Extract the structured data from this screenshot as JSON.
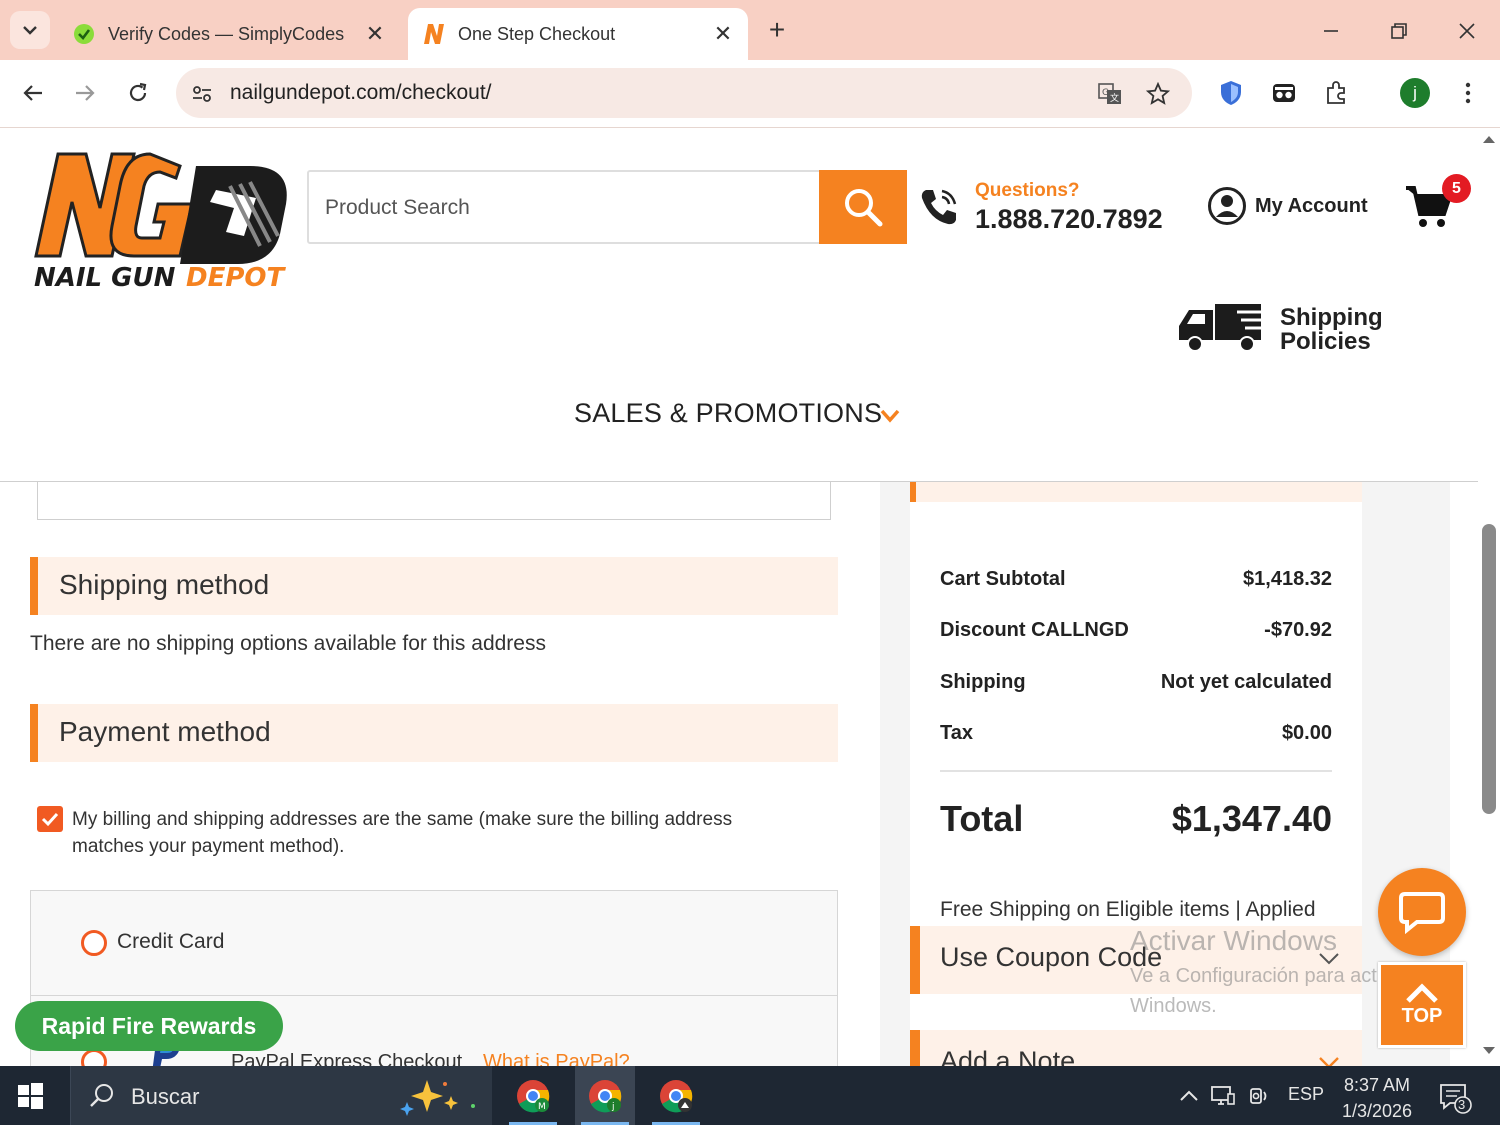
{
  "browser": {
    "tabs": [
      {
        "title": "Verify Codes — SimplyCodes",
        "icon": "simplycodes-icon"
      },
      {
        "title": "One Step Checkout",
        "icon": "ngd-n-icon",
        "active": true
      }
    ],
    "url": "nailgundepot.com/checkout/",
    "profile_initial": "j"
  },
  "header": {
    "logo_main": "NG",
    "logo_text_1": "NAIL GUN",
    "logo_text_2": "DEPOT",
    "search_placeholder": "Product Search",
    "questions_label": "Questions?",
    "phone": "1.888.720.7892",
    "account_label": "My Account",
    "cart_count": "5",
    "shipping_policies_1": "Shipping",
    "shipping_policies_2": "Policies",
    "nav_label": "SALES & PROMOTIONS"
  },
  "checkout": {
    "shipping_title": "Shipping method",
    "shipping_note": "There are no shipping options available for this address",
    "payment_title": "Payment method",
    "billing_same_label": "My billing and shipping addresses are the same (make sure the billing address matches your payment method).",
    "billing_same_checked": true,
    "payment_options": {
      "credit_card": "Credit Card",
      "paypal": "PayPal Express Checkout",
      "paypal_link": "What is PayPal?"
    }
  },
  "summary": {
    "rows": [
      {
        "label": "Cart Subtotal",
        "value": "$1,418.32"
      },
      {
        "label": "Discount CALLNGD",
        "value": "-$70.92"
      },
      {
        "label": "Shipping",
        "value": "Not yet calculated"
      },
      {
        "label": "Tax",
        "value": "$0.00"
      }
    ],
    "total_label": "Total",
    "total_value": "$1,347.40",
    "free_shipping": "Free Shipping on Eligible items | Applied",
    "coupon_title": "Use Coupon Code",
    "note_title": "Add a Note"
  },
  "floating": {
    "rewards": "Rapid Fire Rewards",
    "top": "TOP"
  },
  "watermark": {
    "line1": "Activar Windows",
    "line2": "Ve a Configuración para activar",
    "line3": "Windows."
  },
  "taskbar": {
    "search_label": "Buscar",
    "lang": "ESP",
    "time": "8:37 AM",
    "date": "1/3/2026",
    "notifications": "3"
  },
  "colors": {
    "accent": "#f58220",
    "section_bg": "#fef1e8",
    "rewards_green": "#3aa348",
    "tab_bar": "#f8d0c4"
  }
}
